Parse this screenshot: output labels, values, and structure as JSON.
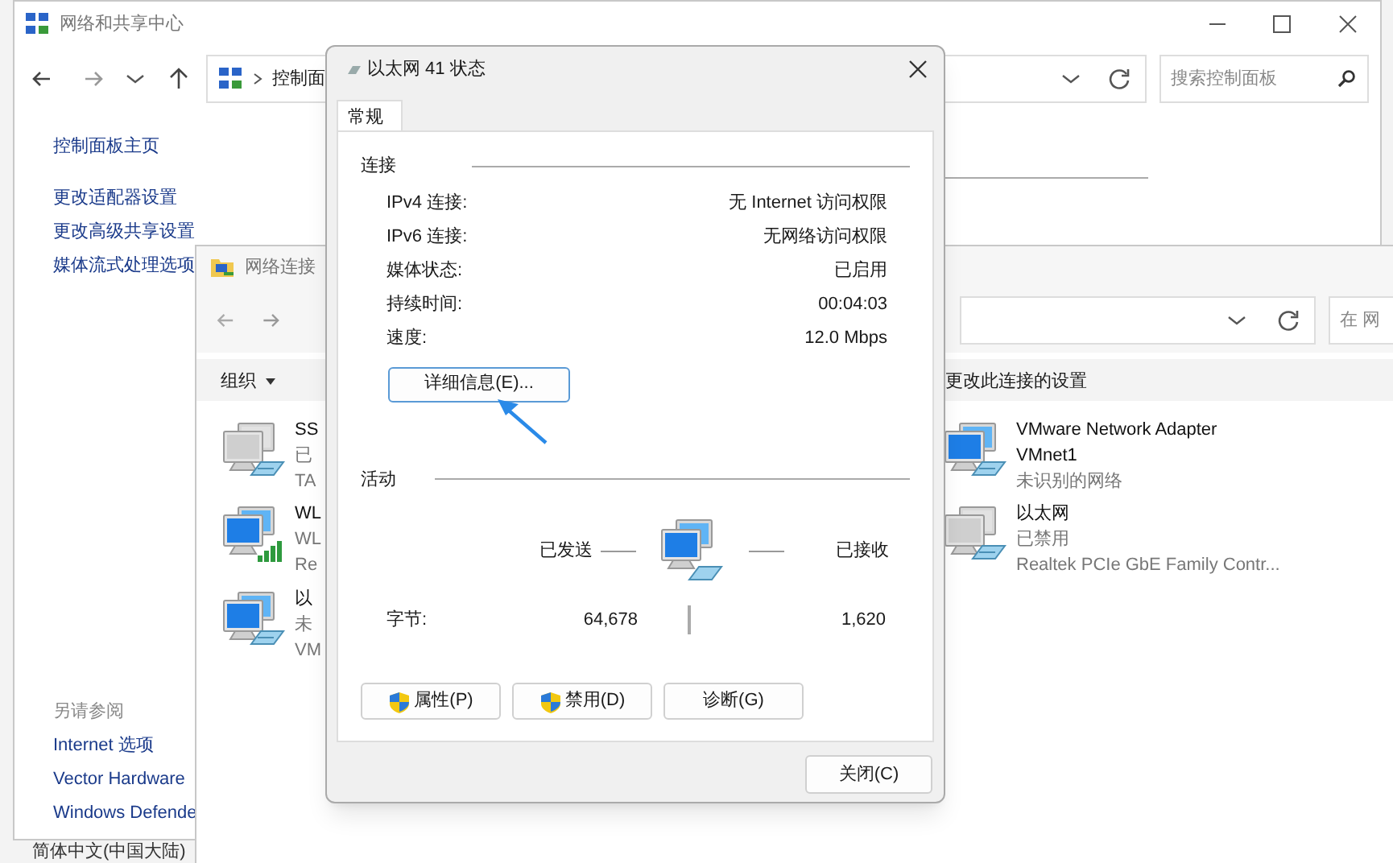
{
  "control_panel_window": {
    "title": "网络和共享中心",
    "breadcrumb": "控制面",
    "search": {
      "placeholder": "搜索控制面板"
    },
    "sidebar": {
      "items": [
        "控制面板主页",
        "更改适配器设置",
        "更改高级共享设置",
        "媒体流式处理选项"
      ],
      "see_also_heading": "另请参阅",
      "see_also": [
        "Internet 选项",
        "Vector Hardware",
        "Windows Defende"
      ]
    }
  },
  "network_connections_window": {
    "title": "网络连接",
    "search": {
      "placeholder": "在 网"
    },
    "toolbar": [
      {
        "label": "组织",
        "dropdown": true
      },
      {
        "label": "更改此连接的设置",
        "dropdown": false
      }
    ],
    "adapters": [
      {
        "name": "SS",
        "status": "已",
        "device": "TA",
        "kind": "wired",
        "disabled": true
      },
      {
        "name": "WL",
        "status": "WL",
        "device": "Re",
        "kind": "wireless",
        "disabled": false
      },
      {
        "name": "以",
        "status": "未",
        "device": "VM",
        "kind": "wired",
        "disabled": false
      },
      {
        "name": "VMware Network Adapter VMnet1",
        "status": "未识别的网络",
        "kind": "wired",
        "disabled": false
      },
      {
        "name": "以太网",
        "status": "已禁用",
        "device": "Realtek PCIe GbE Family Contr...",
        "kind": "wired",
        "disabled": true
      }
    ]
  },
  "language_bar": "简体中文(中国大陆)",
  "status_dialog": {
    "title": "以太网 41 状态",
    "tabs": [
      {
        "label": "常规",
        "selected": true
      }
    ],
    "connection": {
      "heading": "连接",
      "rows": [
        {
          "label": "IPv4 连接:",
          "value": "无 Internet 访问权限"
        },
        {
          "label": "IPv6 连接:",
          "value": "无网络访问权限"
        },
        {
          "label": "媒体状态:",
          "value": "已启用"
        },
        {
          "label": "持续时间:",
          "value": "00:04:03"
        },
        {
          "label": "速度:",
          "value": "12.0 Mbps"
        }
      ]
    },
    "details_button": "详细信息(E)...",
    "activity": {
      "heading": "活动",
      "sent_label": "已发送",
      "received_label": "已接收",
      "bytes_label": "字节:",
      "sent": "64,678",
      "received": "1,620"
    },
    "buttons": [
      {
        "label": "属性(P)",
        "shield": true
      },
      {
        "label": "禁用(D)",
        "shield": true
      },
      {
        "label": "诊断(G)",
        "shield": false
      }
    ],
    "close_button": "关闭(C)"
  }
}
